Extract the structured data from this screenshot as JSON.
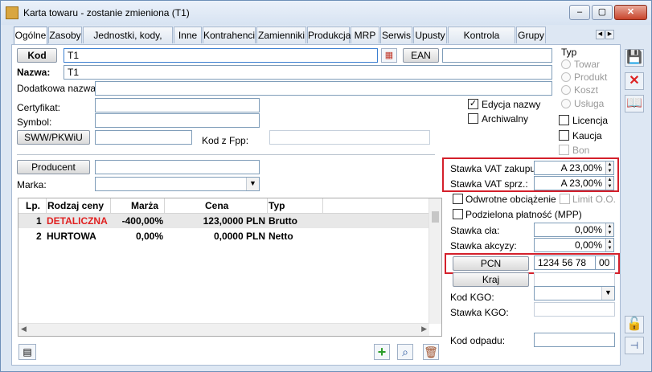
{
  "window": {
    "title": "Karta towaru - zostanie zmieniona (T1)"
  },
  "tabs": [
    {
      "label": "Ogólne",
      "active": true
    },
    {
      "label": "Zasoby"
    },
    {
      "label": "Jednostki, kody, VAT"
    },
    {
      "label": "Inne"
    },
    {
      "label": "Kontrahenci"
    },
    {
      "label": "Zamienniki"
    },
    {
      "label": "Produkcja"
    },
    {
      "label": "MRP"
    },
    {
      "label": "Serwis"
    },
    {
      "label": "Upusty"
    },
    {
      "label": "Kontrola jakości"
    },
    {
      "label": "Grupy"
    }
  ],
  "form": {
    "kod_label": "Kod",
    "kod_value": "T1",
    "ean_label": "EAN",
    "ean_value": "",
    "nazwa_label": "Nazwa:",
    "nazwa_value": "T1",
    "dodatkowa_label": "Dodatkowa nazwa:",
    "certyfikat_label": "Certyfikat:",
    "symbol_label": "Symbol:",
    "sww_label": "SWW/PKWiU",
    "kodfpp_label": "Kod z Fpp:",
    "producent_label": "Producent",
    "marka_label": "Marka:"
  },
  "checks": {
    "edycja_nazwy": {
      "label": "Edycja nazwy",
      "checked": true
    },
    "archiwalny": {
      "label": "Archiwalny",
      "checked": false
    },
    "licencja": {
      "label": "Licencja",
      "checked": false
    },
    "kaucja": {
      "label": "Kaucja",
      "checked": false
    },
    "bon": {
      "label": "Bon",
      "checked": false
    }
  },
  "typ": {
    "legend": "Typ",
    "options": [
      "Towar",
      "Produkt",
      "Koszt",
      "Usługa"
    ]
  },
  "vat": {
    "zakupu_label": "Stawka VAT zakupu:",
    "zakupu_value": "A 23,00%",
    "sprz_label": "Stawka VAT sprz.:",
    "sprz_value": "A 23,00%"
  },
  "right": {
    "odwrotne_label": "Odwrotne obciążenie",
    "limit_label": "Limit O.O.",
    "mpp_label": "Podzielona płatność (MPP)",
    "cla_label": "Stawka cła:",
    "cla_value": "0,00%",
    "akcyzy_label": "Stawka akcyzy:",
    "akcyzy_value": "0,00%",
    "pcn_label": "PCN",
    "pcn_value": "1234 56 78",
    "pcn_suffix": "00",
    "kraj_label": "Kraj",
    "kgo_label": "Kod KGO:",
    "stawka_kgo_label": "Stawka KGO:",
    "kod_odpadu_label": "Kod odpadu:"
  },
  "grid": {
    "columns": [
      "Lp.",
      "Rodzaj ceny",
      "Marża",
      "Cena",
      "Typ"
    ],
    "rows": [
      {
        "lp": "1",
        "rodzaj": "DETALICZNA",
        "marza": "-400,00%",
        "cena": "123,0000 PLN",
        "typ": "Brutto"
      },
      {
        "lp": "2",
        "rodzaj": "HURTOWA",
        "marza": "0,00%",
        "cena": "0,0000 PLN",
        "typ": "Netto"
      }
    ]
  },
  "colors": {
    "highlight": "#d4202b",
    "detaliczna": "#e02020"
  }
}
